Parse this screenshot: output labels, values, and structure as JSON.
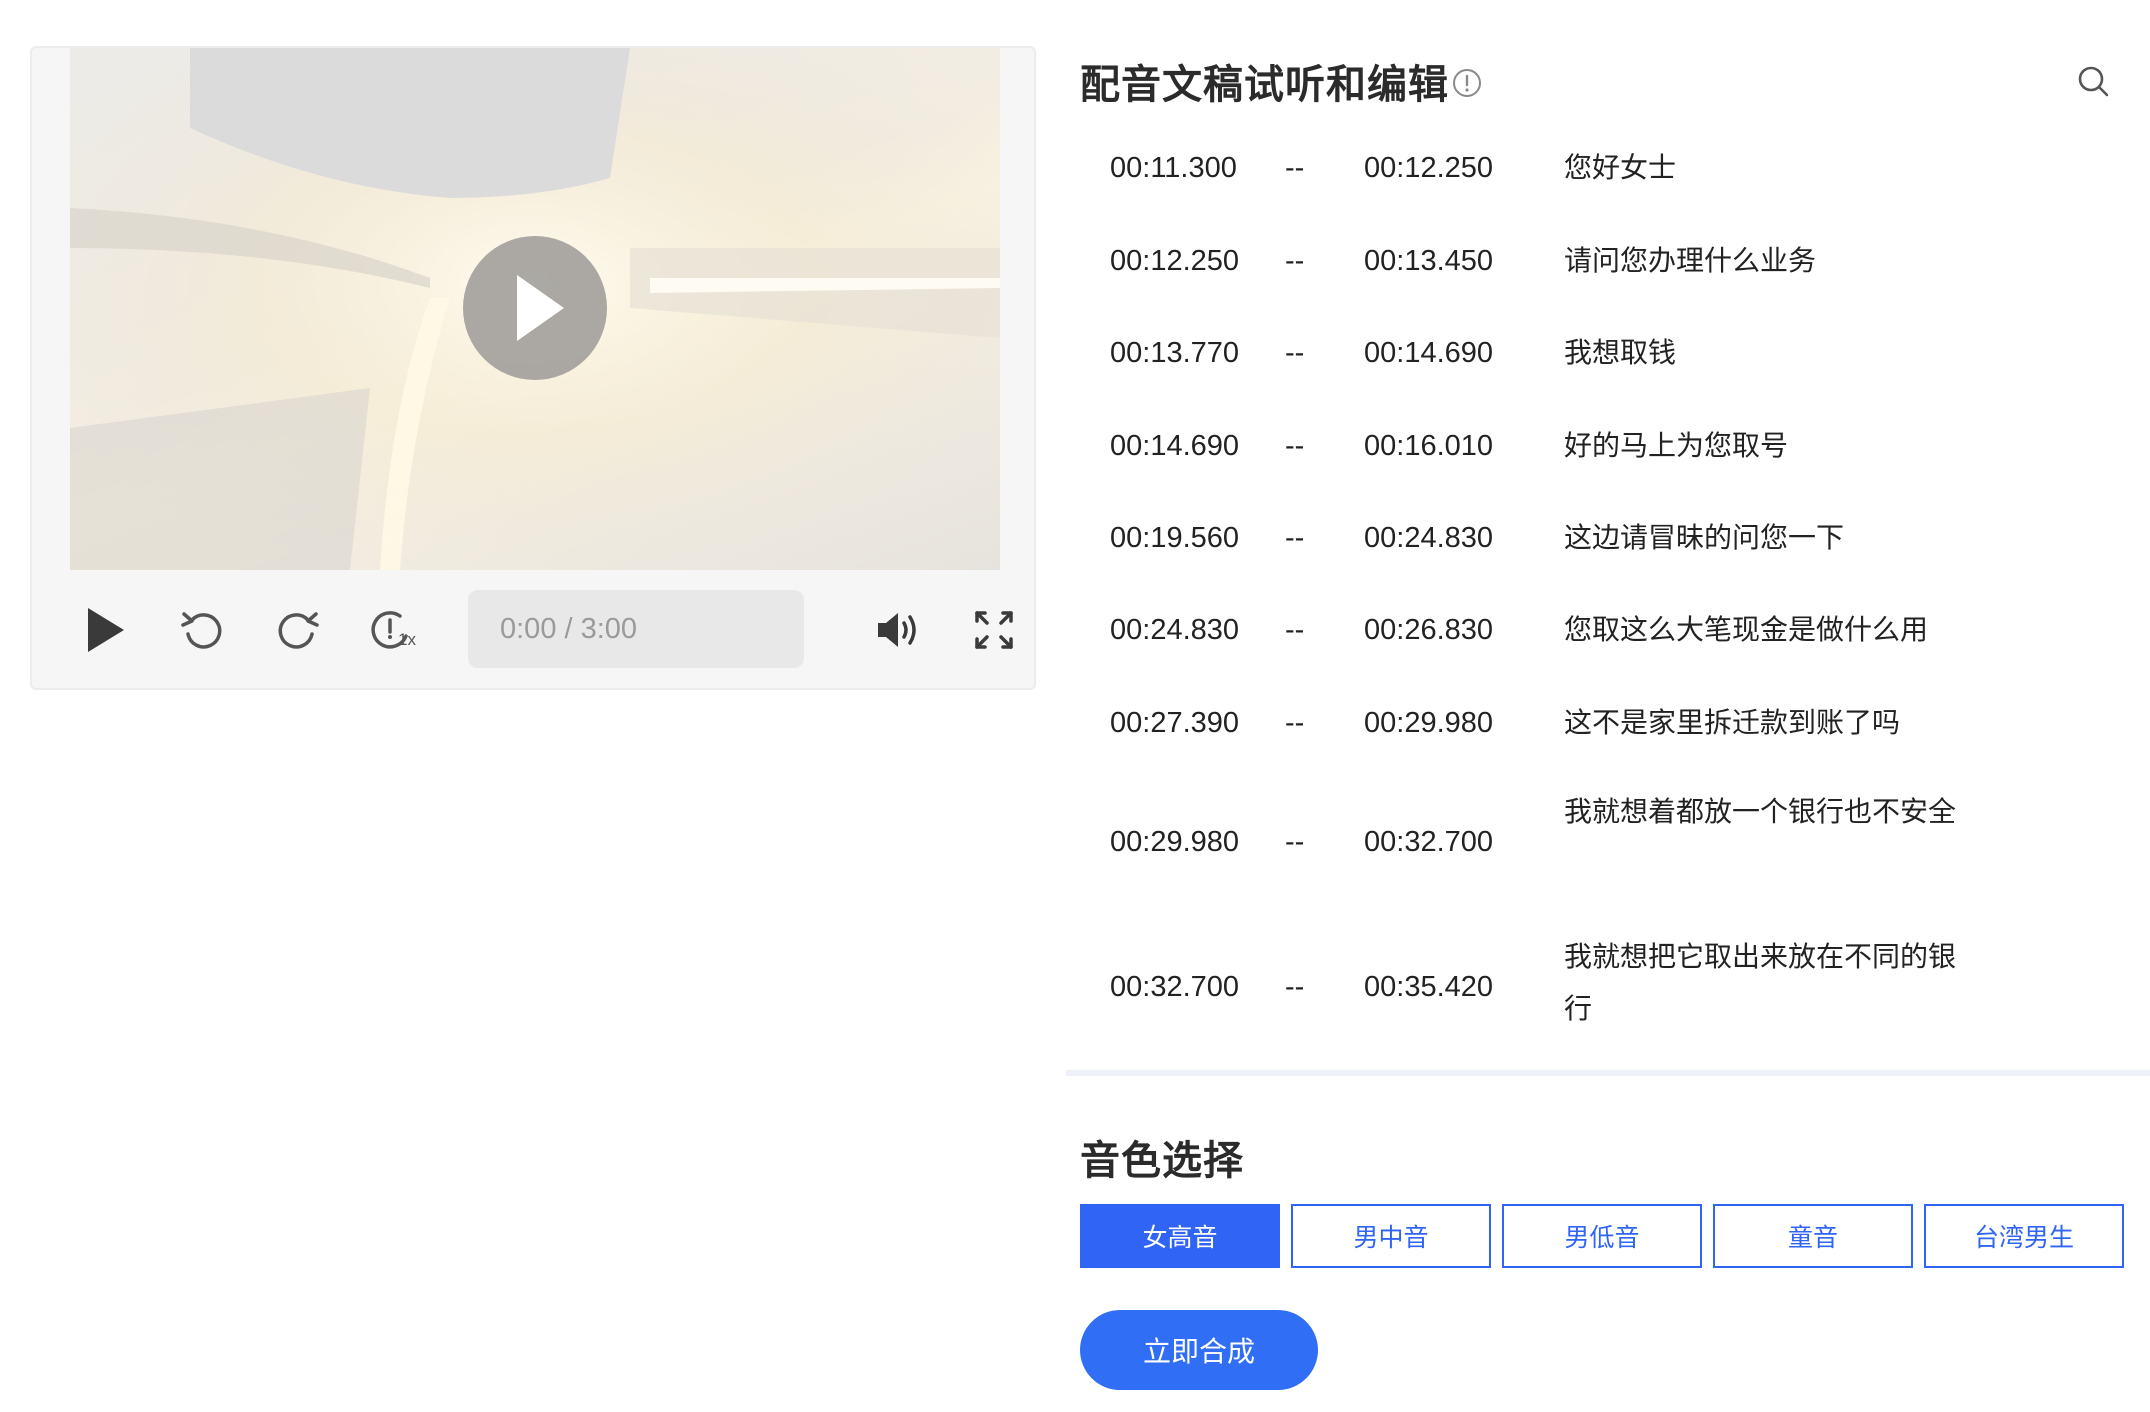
{
  "player": {
    "time_display": "0:00 / 3:00",
    "speed_label": "1x",
    "icons": {
      "big_play": "play-icon",
      "play": "play-icon",
      "rewind": "rewind-icon",
      "forward": "forward-icon",
      "speed": "playback-speed-icon",
      "volume": "volume-icon",
      "fullscreen": "fullscreen-icon"
    }
  },
  "script_panel": {
    "title": "配音文稿试听和编辑",
    "rows": [
      {
        "start": "00:11.300",
        "sep": "--",
        "end": "00:12.250",
        "text": "您好女士"
      },
      {
        "start": "00:12.250",
        "sep": "--",
        "end": "00:13.450",
        "text": "请问您办理什么业务"
      },
      {
        "start": "00:13.770",
        "sep": "--",
        "end": "00:14.690",
        "text": "我想取钱"
      },
      {
        "start": "00:14.690",
        "sep": "--",
        "end": "00:16.010",
        "text": "好的马上为您取号"
      },
      {
        "start": "00:19.560",
        "sep": "--",
        "end": "00:24.830",
        "text": "这边请冒昧的问您一下"
      },
      {
        "start": "00:24.830",
        "sep": "--",
        "end": "00:26.830",
        "text": "您取这么大笔现金是做什么用"
      },
      {
        "start": "00:27.390",
        "sep": "--",
        "end": "00:29.980",
        "text": "这不是家里拆迁款到账了吗"
      },
      {
        "start": "00:29.980",
        "sep": "--",
        "end": "00:32.700",
        "text": "我就想着都放一个银行也不安全"
      },
      {
        "start": "00:32.700",
        "sep": "--",
        "end": "00:35.420",
        "text": "我就想把它取出来放在不同的银行"
      }
    ]
  },
  "voice": {
    "title": "音色选择",
    "options": [
      "女高音",
      "男中音",
      "男低音",
      "童音",
      "台湾男生"
    ],
    "selected": "女高音",
    "synth_label": "立即合成"
  },
  "colors": {
    "accent": "#2f64f5",
    "synth_button": "#2f6ef5",
    "divider": "#eef2f8"
  }
}
